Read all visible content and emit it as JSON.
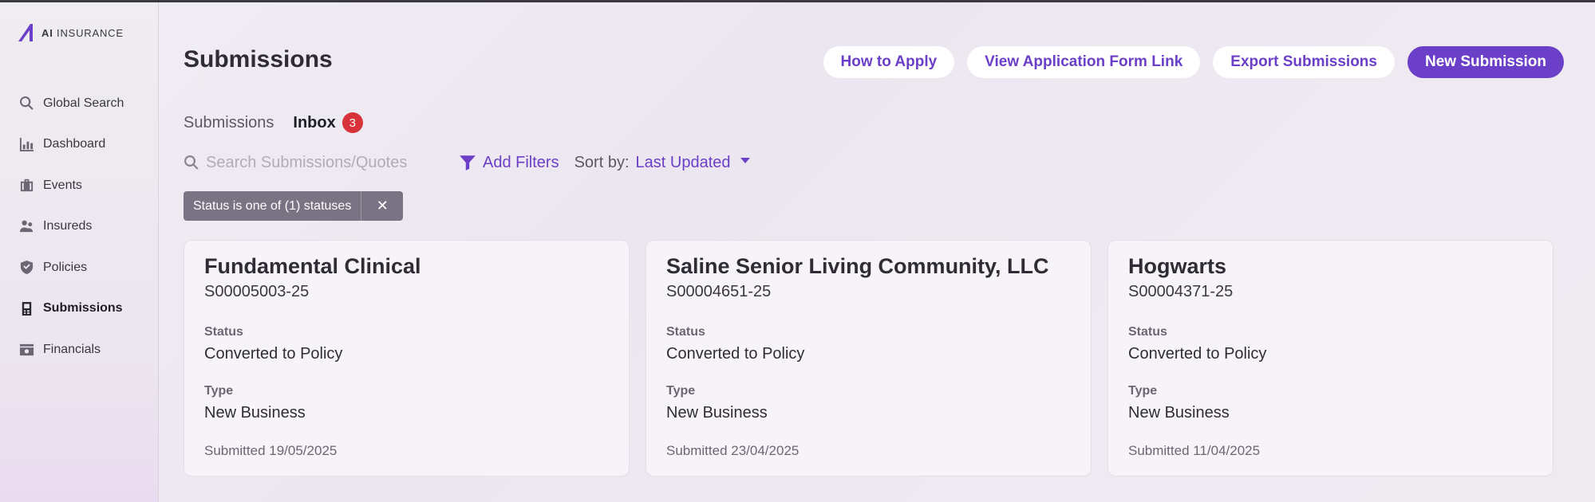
{
  "app": {
    "logo_text_bold": "AI",
    "logo_text": "INSURANCE"
  },
  "sidebar": {
    "items": [
      {
        "label": "Global Search",
        "icon": "search-icon"
      },
      {
        "label": "Dashboard",
        "icon": "chart-icon"
      },
      {
        "label": "Events",
        "icon": "briefcase-icon"
      },
      {
        "label": "Insureds",
        "icon": "people-icon"
      },
      {
        "label": "Policies",
        "icon": "shield-icon"
      },
      {
        "label": "Submissions",
        "icon": "document-icon",
        "active": true
      },
      {
        "label": "Financials",
        "icon": "money-icon"
      }
    ]
  },
  "header": {
    "title": "Submissions",
    "actions": {
      "how_to_apply": "How to Apply",
      "view_form_link": "View Application Form Link",
      "export": "Export Submissions",
      "new_submission": "New Submission"
    }
  },
  "tabs": {
    "submissions": "Submissions",
    "inbox": "Inbox",
    "inbox_count": "3"
  },
  "toolbar": {
    "search_placeholder": "Search Submissions/Quotes",
    "add_filters": "Add Filters",
    "sort_label": "Sort by:",
    "sort_value": "Last Updated"
  },
  "filter_chip": {
    "label": "Status is one of (1) statuses",
    "close": "✕"
  },
  "cards": [
    {
      "title": "Fundamental Clinical",
      "id": "S00005003-25",
      "status_label": "Status",
      "status": "Converted to Policy",
      "type_label": "Type",
      "type": "New Business",
      "submitted": "Submitted 19/05/2025"
    },
    {
      "title": "Saline Senior Living Community, LLC",
      "id": "S00004651-25",
      "status_label": "Status",
      "status": "Converted to Policy",
      "type_label": "Type",
      "type": "New Business",
      "submitted": "Submitted 23/04/2025"
    },
    {
      "title": "Hogwarts",
      "id": "S00004371-25",
      "status_label": "Status",
      "status": "Converted to Policy",
      "type_label": "Type",
      "type": "New Business",
      "submitted": "Submitted 11/04/2025"
    }
  ],
  "colors": {
    "accent": "#6b3fc7",
    "badge": "#d8333a",
    "chip": "#7a7384"
  }
}
